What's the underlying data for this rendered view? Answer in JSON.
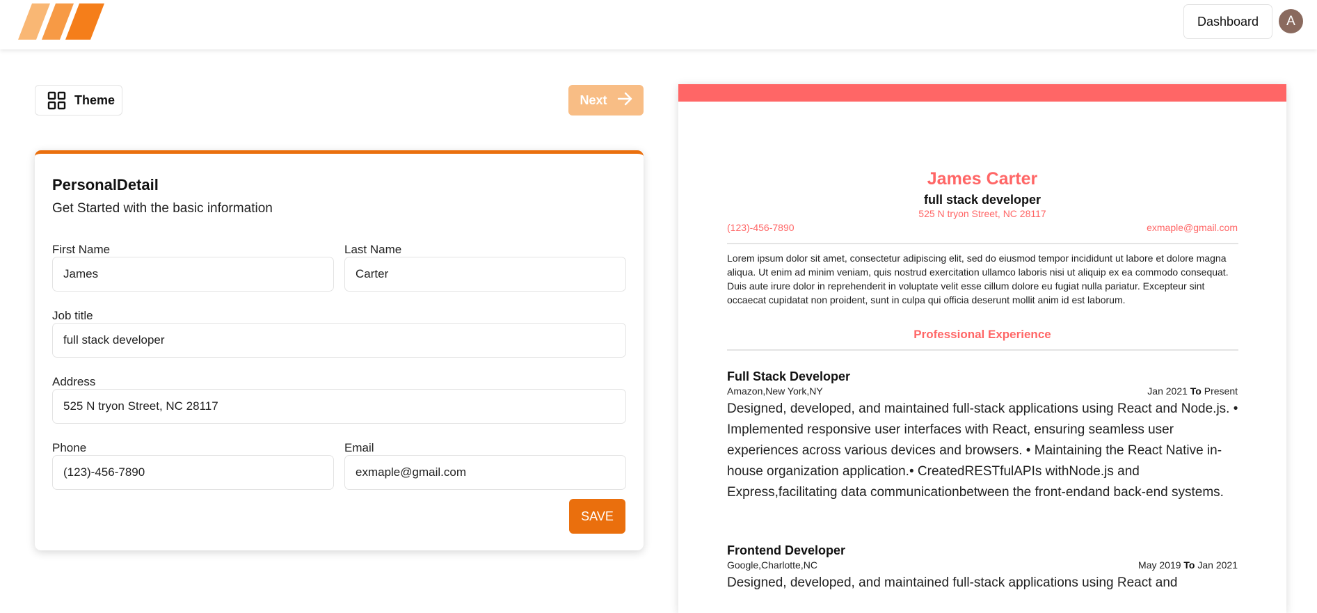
{
  "header": {
    "logo_icon": "brand-stripes-logo",
    "dashboard_label": "Dashboard",
    "avatar_initial": "A"
  },
  "toolbar": {
    "theme_label": "Theme",
    "theme_icon": "grid-icon",
    "next_label": "Next",
    "next_icon": "arrow-right-icon"
  },
  "form": {
    "title": "PersonalDetail",
    "subtitle": "Get Started with the basic information",
    "fields": {
      "first_name": {
        "label": "First Name",
        "value": "James"
      },
      "last_name": {
        "label": "Last Name",
        "value": "Carter"
      },
      "job_title": {
        "label": "Job title",
        "value": "full stack developer"
      },
      "address": {
        "label": "Address",
        "value": "525 N tryon Street, NC 28117"
      },
      "phone": {
        "label": "Phone",
        "value": "(123)-456-7890"
      },
      "email": {
        "label": "Email",
        "value": "exmaple@gmail.com"
      }
    },
    "save_label": "SAVE"
  },
  "resume": {
    "theme_color": "#ff6666",
    "name": "James Carter",
    "job_title": "full stack developer",
    "address": "525 N tryon Street, NC 28117",
    "phone": "(123)-456-7890",
    "email": "exmaple@gmail.com",
    "summary": "Lorem ipsum dolor sit amet, consectetur adipiscing elit, sed do eiusmod tempor incididunt ut labore et dolore magna aliqua. Ut enim ad minim veniam, quis nostrud exercitation ullamco laboris nisi ut aliquip ex ea commodo consequat. Duis aute irure dolor in reprehenderit in voluptate velit esse cillum dolore eu fugiat nulla pariatur. Excepteur sint occaecat cupidatat non proident, sunt in culpa qui officia deserunt mollit anim id est laborum.",
    "experience_heading": "Professional Experience",
    "date_separator": "To",
    "experience": [
      {
        "title": "Full Stack Developer",
        "company": "Amazon,New York,NY",
        "start": "Jan 2021",
        "end": "Present",
        "description": "Designed, developed, and maintained full-stack applications using React and Node.js. • Implemented responsive user interfaces with React, ensuring seamless user experiences across various devices and browsers. • Maintaining the React Native in-house organization application.• CreatedRESTfulAPIs withNode.js and Express,facilitating data communicationbetween the front-endand back-end systems."
      },
      {
        "title": "Frontend Developer",
        "company": "Google,Charlotte,NC",
        "start": "May 2019",
        "end": "Jan 2021",
        "description": "Designed, developed, and maintained full-stack applications using React and"
      }
    ]
  },
  "colors": {
    "accent_orange": "#ea6f0d",
    "next_button_disabled": "#f8bd85",
    "resume_accent": "#ff6666",
    "avatar_bg": "#8a6a5e"
  }
}
